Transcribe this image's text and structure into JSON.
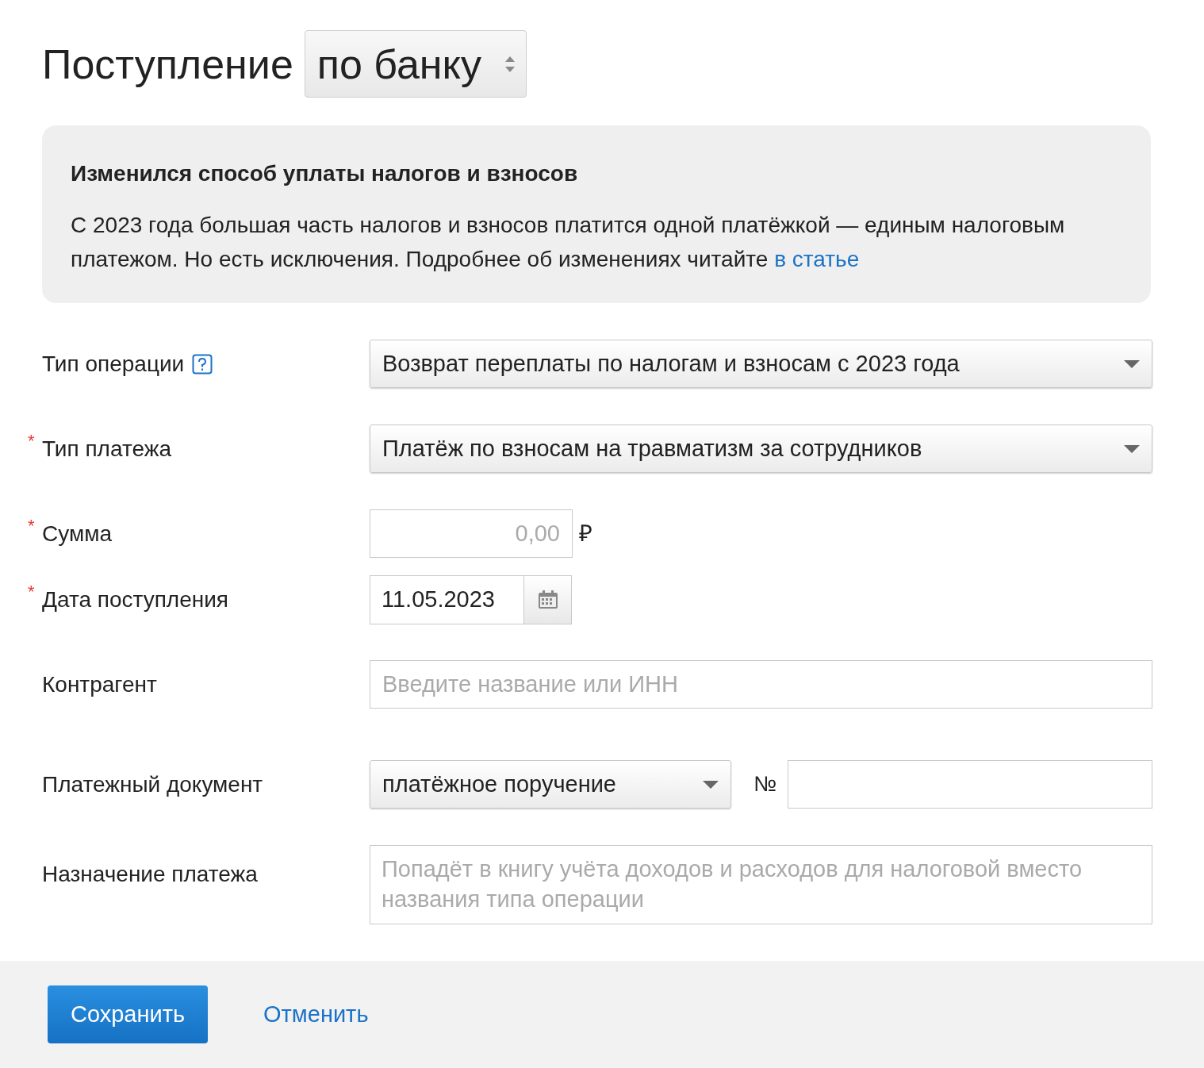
{
  "title": "Поступление",
  "title_select": {
    "value": "по банку"
  },
  "notice": {
    "heading": "Изменился способ уплаты налогов и взносов",
    "text": "С 2023 года большая часть налогов и взносов платится одной платёжкой — единым налоговым платежом. Но есть исключения. Подробнее об изменениях читайте",
    "link": "в статье"
  },
  "fields": [
    {
      "kind": "select",
      "label": "Тип операции",
      "help": true,
      "value": "Возврат переплаты по налогам и взносам с 2023 года"
    },
    {
      "kind": "select",
      "label": "Тип платежа",
      "required_mark": "*",
      "help": false,
      "value": "Платёж по взносам на травматизм за сотрудников"
    },
    {
      "kind": "amount",
      "label": "Сумма",
      "required_mark": "*",
      "help": false,
      "placeholder": "0,00",
      "currency": "₽"
    },
    {
      "kind": "date",
      "label": "Дата поступления",
      "required_mark": "*",
      "help": false,
      "value": "11.05.2023"
    },
    {
      "kind": "text",
      "label": "Контрагент",
      "help": false,
      "placeholder": "Введите название или ИНН"
    },
    {
      "kind": "document",
      "label": "Платежный документ",
      "help": false,
      "value": "платёжное поручение",
      "number_label": "№"
    },
    {
      "kind": "textarea",
      "label": "Назначение платежа",
      "help": false,
      "placeholder": "Попадёт в книгу учёта доходов и расходов для налоговой вместо названия типа операции"
    }
  ],
  "buttons": {
    "save": "Сохранить",
    "cancel": "Отменить"
  }
}
